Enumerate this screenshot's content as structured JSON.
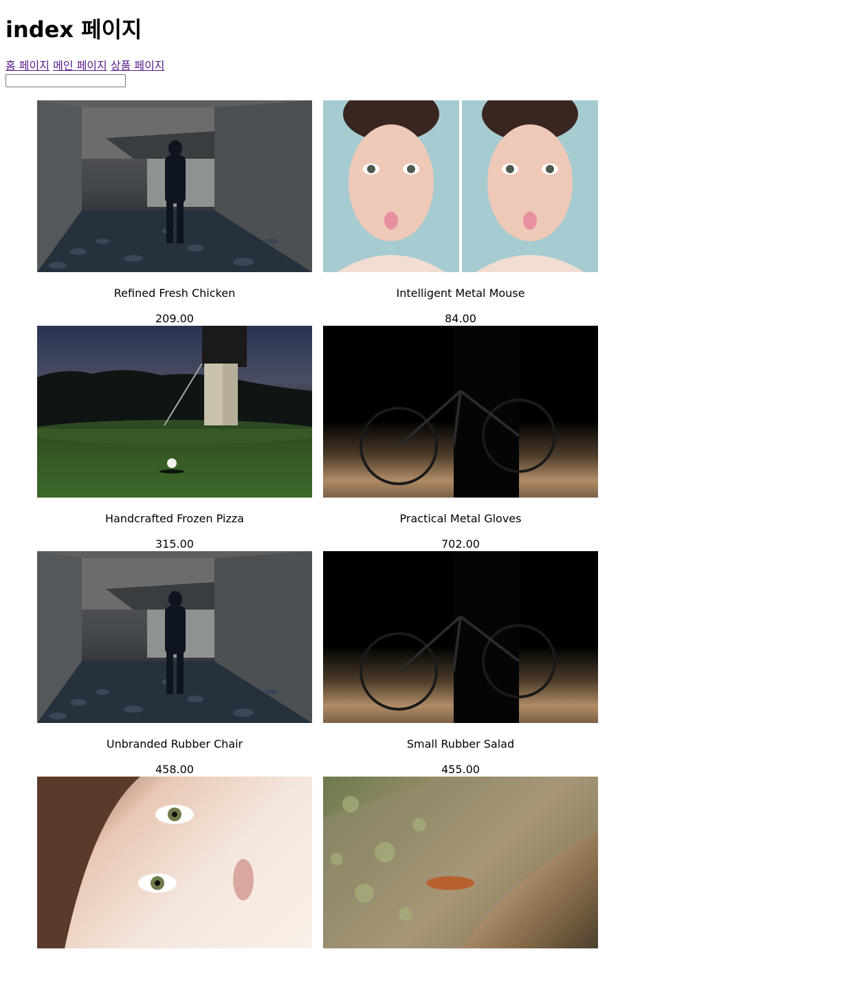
{
  "page": {
    "title": "index 페이지"
  },
  "nav": {
    "links": [
      "홈 페이지",
      "메인 페이지",
      "상품 페이지"
    ]
  },
  "search": {
    "value": ""
  },
  "products": [
    {
      "name": "Refined Fresh Chicken",
      "price": "209.00",
      "image": "tunnel-photo"
    },
    {
      "name": "Intelligent Metal Mouse",
      "price": "84.00",
      "image": "face-photo"
    },
    {
      "name": "Handcrafted Frozen Pizza",
      "price": "315.00",
      "image": "golf-photo"
    },
    {
      "name": "Practical Metal Gloves",
      "price": "702.00",
      "image": "bike-photo"
    },
    {
      "name": "Unbranded Rubber Chair",
      "price": "458.00",
      "image": "tunnel-photo"
    },
    {
      "name": "Small Rubber Salad",
      "price": "455.00",
      "image": "bike-photo"
    },
    {
      "name": "",
      "price": "",
      "image": "eye-photo"
    },
    {
      "name": "",
      "price": "",
      "image": "rock-photo"
    }
  ]
}
